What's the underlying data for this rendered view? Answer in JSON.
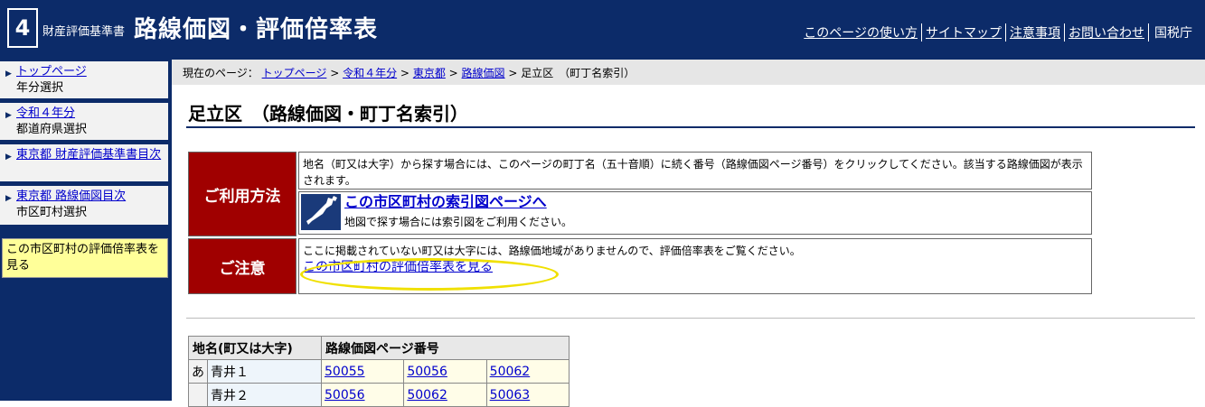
{
  "header": {
    "logo_number": "4",
    "logo_small": "財産評価基準書",
    "title": "路線価図・評価倍率表",
    "links": [
      "このページの使い方",
      "サイトマップ",
      "注意事項",
      "お問い合わせ"
    ],
    "agency": "国税庁"
  },
  "sidebar": {
    "items": [
      {
        "link": "トップページ",
        "sub": "年分選択"
      },
      {
        "link": "令和４年分",
        "sub": "都道府県選択"
      },
      {
        "link": "東京都 財産評価基準書目次",
        "sub": ""
      },
      {
        "link": "東京都 路線価図目次",
        "sub": "市区町村選択"
      }
    ],
    "current": "この市区町村の評価倍率表を見る"
  },
  "breadcrumb": {
    "prefix": "現在のページ：",
    "links": [
      "トップページ",
      "令和４年分",
      "東京都",
      "路線価図"
    ],
    "current": "足立区　（町丁名索引）",
    "sep": ">"
  },
  "page": {
    "title": "足立区　（路線価図・町丁名索引）"
  },
  "info": {
    "usage_label": "ご利用方法",
    "usage_text": "地名（町又は大字）から探す場合には、このページの町丁名（五十音順）に続く番号（路線価図ページ番号）をクリックしてください。該当する路線価図が表示されます。",
    "map_link": "この市区町村の索引図ページへ",
    "map_note": "地図で探す場合には索引図をご利用ください。",
    "caution_label": "ご注意",
    "caution_text": "ここに掲載されていない町又は大字には、路線価地域がありませんので、評価倍率表をご覧ください。",
    "caution_link": "この市区町村の評価倍率表を見る"
  },
  "table": {
    "headers": [
      "地名(町又は大字)",
      "路線価図ページ番号"
    ],
    "rows": [
      {
        "kana": "あ",
        "place": "青井１",
        "pages": [
          "50055",
          "50056",
          "50062"
        ]
      },
      {
        "kana": "",
        "place": "青井２",
        "pages": [
          "50056",
          "50062",
          "50063"
        ]
      }
    ]
  }
}
